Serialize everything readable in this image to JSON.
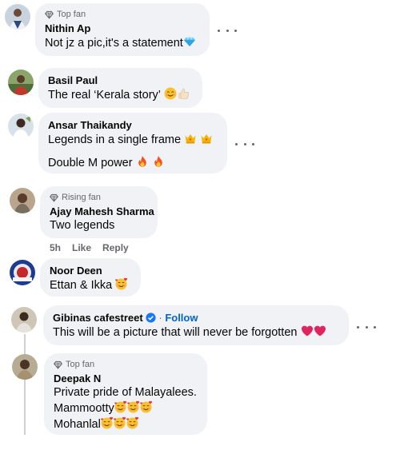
{
  "comments": [
    {
      "badge": "Top fan",
      "name": "Nithin Ap",
      "text": "Not jz a pic,it's a statement",
      "text_emoji": "gem-icon"
    },
    {
      "name": "Basil Paul",
      "text": "The real ‘Kerala story’",
      "text_emoji": [
        "smiling-face-icon",
        "thumbs-up-icon"
      ]
    },
    {
      "name": "Ansar Thaikandy",
      "lines": [
        "Legends in a single frame",
        "Double M power"
      ],
      "line_emojis": [
        [
          "crown-icon",
          "crown-icon"
        ],
        [
          "fire-icon",
          "fire-icon"
        ]
      ]
    },
    {
      "badge": "Rising fan",
      "name": "Ajay Mahesh Sharma",
      "text": "Two legends",
      "time": "5h",
      "like_label": "Like",
      "reply_label": "Reply"
    },
    {
      "name": "Noor Deen",
      "text": "Ettan & Ikka",
      "text_emoji": "smiling-hearts-icon"
    },
    {
      "name": "Gibinas cafestreet",
      "follow_label": "Follow",
      "separator": "·",
      "text": "This will be a picture that will never be forgotten",
      "text_emoji": [
        "red-heart-icon",
        "red-heart-icon"
      ]
    },
    {
      "badge": "Top fan",
      "name": "Deepak N",
      "lines": [
        "Private pride of Malayalees.",
        "Mammootty",
        "Mohanlal"
      ],
      "line_emojis": [
        [],
        [
          "smiling-hearts-icon",
          "smiling-hearts-icon",
          "smiling-hearts-icon"
        ],
        [
          "smiling-hearts-icon",
          "smiling-hearts-icon",
          "smiling-hearts-icon"
        ]
      ]
    }
  ],
  "colors": {
    "bubble": "#f0f2f5",
    "name": "#050505",
    "secondary": "#65676b",
    "follow": "#0064d1",
    "thread": "#ced0d4"
  }
}
